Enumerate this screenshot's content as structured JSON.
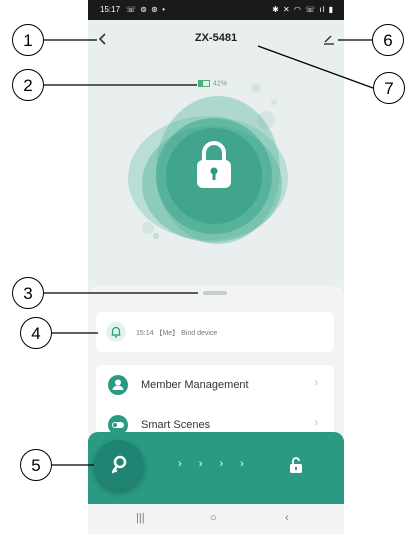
{
  "status_bar": {
    "time": "15:17",
    "left_icons": "☏ ⊚ ⊛ •",
    "right_icons": "✱ ✕ ◠ ☏ ıl ▮"
  },
  "header": {
    "title": "ZX-5481"
  },
  "battery": {
    "percent_text": "42%",
    "level": 0.42
  },
  "log": {
    "text": "15:14 【Me】 Bind device"
  },
  "menu": {
    "items": [
      {
        "label": "Member Management",
        "icon": "person-icon"
      },
      {
        "label": "Smart Scenes",
        "icon": "toggle-icon"
      }
    ]
  },
  "action_bar": {
    "arrows": "› › › ›"
  },
  "nav": {
    "recent": "|||",
    "home": "○",
    "back": "‹"
  },
  "callouts": [
    "1",
    "2",
    "3",
    "4",
    "5",
    "6",
    "7"
  ],
  "colors": {
    "accent": "#2a9a83",
    "accent_dark": "#1f8572",
    "background": "#e8efee"
  }
}
